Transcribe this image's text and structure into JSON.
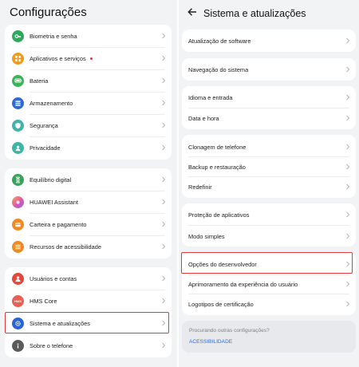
{
  "left": {
    "title": "Configurações",
    "groups": [
      {
        "items": [
          {
            "label": "Biometria e senha",
            "icon": "key-icon",
            "color": "#2ea85a"
          },
          {
            "label": "Aplicativos e serviços",
            "icon": "apps-grid-icon",
            "color": "#f39a1d",
            "badge": true
          },
          {
            "label": "Bateria",
            "icon": "battery-icon",
            "color": "#3cb25a"
          },
          {
            "label": "Armazenamento",
            "icon": "storage-icon",
            "color": "#2e6ad6"
          },
          {
            "label": "Segurança",
            "icon": "shield-icon",
            "color": "#3fb5a8"
          },
          {
            "label": "Privacidade",
            "icon": "privacy-icon",
            "color": "#3fb5a8"
          }
        ]
      },
      {
        "items": [
          {
            "label": "Equilíbrio digital",
            "icon": "hourglass-icon",
            "color": "#3aa35b"
          },
          {
            "label": "HUAWEI Assistant",
            "icon": "assistant-icon",
            "color": "#c069d6"
          },
          {
            "label": "Carteira e pagamento",
            "icon": "wallet-icon",
            "color": "#f08a24"
          },
          {
            "label": "Recursos de acessibilidade",
            "icon": "accessibility-icon",
            "color": "#f08a24"
          }
        ]
      },
      {
        "items": [
          {
            "label": "Usuários e contas",
            "icon": "user-icon",
            "color": "#e5473b"
          },
          {
            "label": "HMS Core",
            "icon": "hms-core-icon",
            "color": "#e96057",
            "icon_text": "HMS"
          },
          {
            "label": "Sistema e atualizações",
            "icon": "system-gear-icon",
            "color": "#2a63d4"
          },
          {
            "label": "Sobre o telefone",
            "icon": "info-icon",
            "color": "#5a5a5a"
          }
        ]
      }
    ]
  },
  "right": {
    "title": "Sistema e atualizações",
    "groups": [
      {
        "items": [
          {
            "label": "Atualização de software"
          }
        ]
      },
      {
        "items": [
          {
            "label": "Navegação do sistema"
          }
        ]
      },
      {
        "items": [
          {
            "label": "Idioma e entrada"
          },
          {
            "label": "Data e hora"
          }
        ]
      },
      {
        "items": [
          {
            "label": "Clonagem de telefone"
          },
          {
            "label": "Backup e restauração"
          },
          {
            "label": "Redefinir"
          }
        ]
      },
      {
        "items": [
          {
            "label": "Proteção de aplicativos"
          },
          {
            "label": "Modo simples"
          }
        ]
      },
      {
        "items": [
          {
            "label": "Opções do desenvolvedor"
          },
          {
            "label": "Aprimoramento da experiência do usuário"
          },
          {
            "label": "Logotipos de certificação"
          }
        ]
      }
    ],
    "hint": {
      "question": "Procurando outras configurações?",
      "link": "ACESSIBILIDADE"
    }
  },
  "highlight_color": "#e0393e"
}
